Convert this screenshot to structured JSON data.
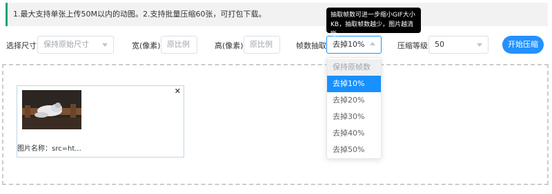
{
  "notice": "1.最大支持单张上传50M以内的动图。2.支持批量压缩60张，可打包下载。",
  "tooltip": {
    "line1": "抽取帧数可进一步缩小GIF大小",
    "line2": "KB，抽取帧数越少，图片越清晰。"
  },
  "controls": {
    "size_label": "选择尺寸",
    "size_value": "保持原始尺寸",
    "width_label": "宽(像素)",
    "width_placeholder": "原比例",
    "height_label": "高(像素)",
    "height_placeholder": "原比例",
    "frame_label": "帧数抽取",
    "frame_value": "去掉10%",
    "level_label": "压缩等级",
    "level_value": "50",
    "start_button": "开始压缩"
  },
  "frame_options": [
    "保持原帧数",
    "去掉10%",
    "去掉20%",
    "去掉30%",
    "去掉40%",
    "去掉50%"
  ],
  "card": {
    "name": "图片名称：src=ht...",
    "close_icon": "close-icon"
  },
  "colors": {
    "accent": "#2391ff",
    "notice_border": "#1aa177"
  }
}
